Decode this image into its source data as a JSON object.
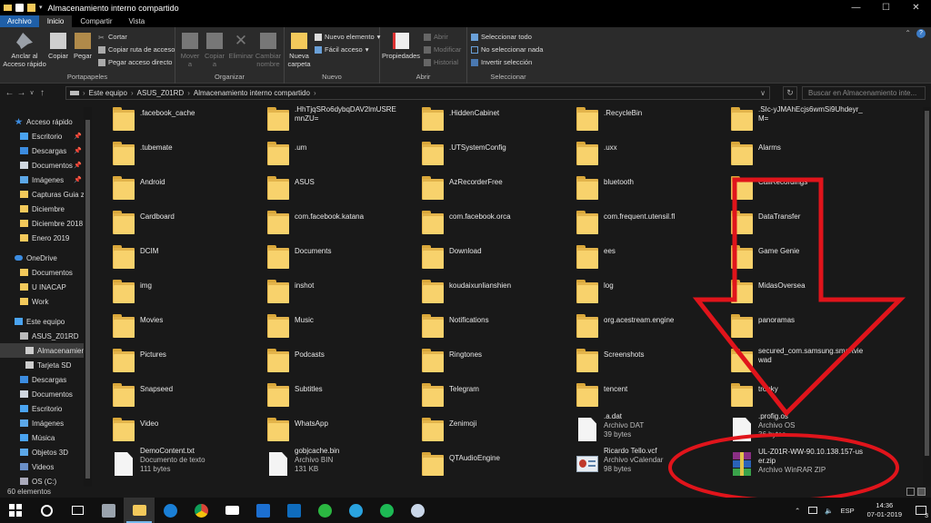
{
  "window": {
    "title": "Almacenamiento interno compartido"
  },
  "ribbon_tabs": [
    "Archivo",
    "Inicio",
    "Compartir",
    "Vista"
  ],
  "ribbon": {
    "portapapeles": {
      "label": "Portapapeles",
      "pin": "Anclar al Acceso rápido",
      "copy": "Copiar",
      "paste": "Pegar",
      "cut": "Cortar",
      "copy_path": "Copiar ruta de acceso",
      "paste_shortcut": "Pegar acceso directo"
    },
    "organizar": {
      "label": "Organizar",
      "move": "Mover a",
      "copy_to": "Copiar a",
      "delete": "Eliminar",
      "rename": "Cambiar nombre"
    },
    "nuevo": {
      "label": "Nuevo",
      "new_folder": "Nueva carpeta",
      "new_item": "Nuevo elemento",
      "easy_access": "Fácil acceso"
    },
    "abrir": {
      "label": "Abrir",
      "properties": "Propiedades",
      "open": "Abrir",
      "modify": "Modificar",
      "history": "Historial"
    },
    "seleccionar": {
      "label": "Seleccionar",
      "select_all": "Seleccionar todo",
      "select_none": "No seleccionar nada",
      "invert": "Invertir selección"
    }
  },
  "address": {
    "crumbs": [
      "Este equipo",
      "ASUS_Z01RD",
      "Almacenamiento interno compartido"
    ],
    "search_placeholder": "Buscar en Almacenamiento inte..."
  },
  "nav": [
    {
      "label": "Acceso rápido",
      "icon": "star-icon",
      "pin": false
    },
    {
      "label": "Escritorio",
      "icon": "desktop-icon",
      "pin": true
    },
    {
      "label": "Descargas",
      "icon": "download-icon",
      "pin": true
    },
    {
      "label": "Documentos",
      "icon": "documents-icon",
      "pin": true
    },
    {
      "label": "Imágenes",
      "icon": "pictures-icon",
      "pin": true
    },
    {
      "label": "Capturas Guia ze",
      "icon": "folder-icon",
      "pin": false
    },
    {
      "label": "Diciembre",
      "icon": "folder-icon",
      "pin": false
    },
    {
      "label": "Diciembre 2018",
      "icon": "folder-icon",
      "pin": false
    },
    {
      "label": "Enero 2019",
      "icon": "folder-icon",
      "pin": false
    },
    {
      "label": "OneDrive",
      "icon": "cloud-icon",
      "pin": false
    },
    {
      "label": "Documentos",
      "icon": "folder-icon",
      "pin": false
    },
    {
      "label": "U INACAP",
      "icon": "folder-icon",
      "pin": false
    },
    {
      "label": "Work",
      "icon": "folder-icon",
      "pin": false
    },
    {
      "label": "Este equipo",
      "icon": "computer-icon",
      "pin": false
    },
    {
      "label": "ASUS_Z01RD",
      "icon": "phone-icon",
      "pin": false
    },
    {
      "label": "Almacenamien",
      "icon": "drive-icon",
      "pin": false
    },
    {
      "label": "Tarjeta SD",
      "icon": "drive-icon",
      "pin": false
    },
    {
      "label": "Descargas",
      "icon": "download-icon",
      "pin": false
    },
    {
      "label": "Documentos",
      "icon": "documents-icon",
      "pin": false
    },
    {
      "label": "Escritorio",
      "icon": "desktop-icon",
      "pin": false
    },
    {
      "label": "Imágenes",
      "icon": "pictures-icon",
      "pin": false
    },
    {
      "label": "Música",
      "icon": "music-icon",
      "pin": false
    },
    {
      "label": "Objetos 3D",
      "icon": "cube-icon",
      "pin": false
    },
    {
      "label": "Videos",
      "icon": "video-icon",
      "pin": false
    },
    {
      "label": "OS (C:)",
      "icon": "disk-icon",
      "pin": false
    }
  ],
  "pin_glyph": "📌",
  "items": [
    {
      "name": ".facebook_cache",
      "type": "folder"
    },
    {
      "name": ".HhTjqSRo6dybqDAV2lmUSREmnZU=",
      "type": "folder"
    },
    {
      "name": ".HiddenCabinet",
      "type": "folder"
    },
    {
      "name": ".RecycleBin",
      "type": "folder"
    },
    {
      "name": ".SIc-yJMAhEcjs6wmSi9Uhdeyr_M=",
      "type": "folder"
    },
    {
      "name": ".tubemate",
      "type": "folder"
    },
    {
      "name": ".um",
      "type": "folder"
    },
    {
      "name": ".UTSystemConfig",
      "type": "folder"
    },
    {
      "name": ".uxx",
      "type": "folder"
    },
    {
      "name": "Alarms",
      "type": "folder"
    },
    {
      "name": "Android",
      "type": "folder"
    },
    {
      "name": "ASUS",
      "type": "folder"
    },
    {
      "name": "AzRecorderFree",
      "type": "folder"
    },
    {
      "name": "bluetooth",
      "type": "folder"
    },
    {
      "name": "CallRecordings",
      "type": "folder"
    },
    {
      "name": "Cardboard",
      "type": "folder"
    },
    {
      "name": "com.facebook.katana",
      "type": "folder"
    },
    {
      "name": "com.facebook.orca",
      "type": "folder"
    },
    {
      "name": "com.frequent.utensil.fl",
      "type": "folder"
    },
    {
      "name": "DataTransfer",
      "type": "folder"
    },
    {
      "name": "DCIM",
      "type": "folder"
    },
    {
      "name": "Documents",
      "type": "folder"
    },
    {
      "name": "Download",
      "type": "folder"
    },
    {
      "name": "ees",
      "type": "folder"
    },
    {
      "name": "Game Genie",
      "type": "folder"
    },
    {
      "name": "img",
      "type": "folder"
    },
    {
      "name": "inshot",
      "type": "folder"
    },
    {
      "name": "koudaixunlianshien",
      "type": "folder"
    },
    {
      "name": "log",
      "type": "folder"
    },
    {
      "name": "MidasOversea",
      "type": "folder"
    },
    {
      "name": "Movies",
      "type": "folder"
    },
    {
      "name": "Music",
      "type": "folder"
    },
    {
      "name": "Notifications",
      "type": "folder"
    },
    {
      "name": "org.acestream.engine",
      "type": "folder"
    },
    {
      "name": "panoramas",
      "type": "folder"
    },
    {
      "name": "Pictures",
      "type": "folder"
    },
    {
      "name": "Podcasts",
      "type": "folder"
    },
    {
      "name": "Ringtones",
      "type": "folder"
    },
    {
      "name": "Screenshots",
      "type": "folder"
    },
    {
      "name": "secured_com.samsung.smartviewad",
      "type": "folder"
    },
    {
      "name": "Snapseed",
      "type": "folder"
    },
    {
      "name": "Subtitles",
      "type": "folder"
    },
    {
      "name": "Telegram",
      "type": "folder"
    },
    {
      "name": "tencent",
      "type": "folder"
    },
    {
      "name": "tronky",
      "type": "folder"
    },
    {
      "name": "Video",
      "type": "folder"
    },
    {
      "name": "WhatsApp",
      "type": "folder"
    },
    {
      "name": "Zenimoji",
      "type": "folder"
    },
    {
      "name": ".a.dat",
      "type": "file",
      "kind": "Archivo DAT",
      "size": "39 bytes"
    },
    {
      "name": ".profig.os",
      "type": "file",
      "kind": "Archivo OS",
      "size": "36 bytes"
    },
    {
      "name": "DemoContent.txt",
      "type": "file",
      "kind": "Documento de texto",
      "size": "111 bytes"
    },
    {
      "name": "gobjcache.bin",
      "type": "file",
      "kind": "Archivo BIN",
      "size": "131 KB"
    },
    {
      "name": "QTAudioEngine",
      "type": "folder"
    },
    {
      "name": "Ricardo Tello.vcf",
      "type": "vcard",
      "kind": "Archivo vCalendar",
      "size": "98 bytes"
    },
    {
      "name": "UL-Z01R-WW-90.10.138.157-user.zip",
      "type": "rar",
      "kind": "Archivo WinRAR ZIP",
      "size": ""
    }
  ],
  "status": {
    "count": "60 elementos"
  },
  "tray": {
    "lang": "ESP",
    "time": "14:36",
    "date": "07-01-2019",
    "notif_count": "3"
  },
  "colors": {
    "annotation": "#e0141b",
    "accent": "#1f5fa8",
    "folder": "#f3c95b"
  }
}
